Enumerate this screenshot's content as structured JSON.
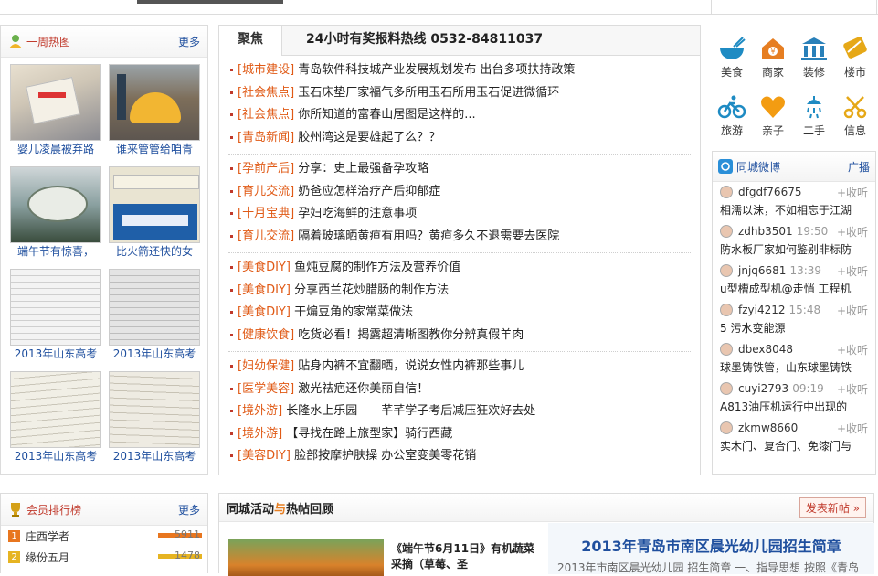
{
  "hot_week": {
    "title": "一周热图",
    "more": "更多",
    "items": [
      {
        "caption": "婴儿凌晨被弃路"
      },
      {
        "caption": "谁来管管给咱青"
      },
      {
        "caption": "端午节有惊喜，"
      },
      {
        "caption": "比火箭还快的女"
      },
      {
        "caption": "2013年山东高考"
      },
      {
        "caption": "2013年山东高考"
      },
      {
        "caption": "2013年山东高考"
      },
      {
        "caption": "2013年山东高考"
      }
    ]
  },
  "focus": {
    "tab_active": "聚焦",
    "hotline": "24小时有奖报料热线 0532-84811037",
    "groups": [
      [
        {
          "cat": "[城市建设]",
          "title": "青岛软件科技城产业发展规划发布 出台多项扶持政策"
        },
        {
          "cat": "[社会焦点]",
          "title": "玉石床垫厂家福气多所用玉石所用玉石促进微循环"
        },
        {
          "cat": "[社会焦点]",
          "title": "你所知道的富春山居图是这样的..."
        },
        {
          "cat": "[青岛新闻]",
          "title": "胶州湾这是要雄起了么？？"
        }
      ],
      [
        {
          "cat": "[孕前产后]",
          "title": "分享：史上最强备孕攻略"
        },
        {
          "cat": "[育儿交流]",
          "title": "奶爸应怎样治疗产后抑郁症"
        },
        {
          "cat": "[十月宝典]",
          "title": "孕妇吃海鲜的注意事项"
        },
        {
          "cat": "[育儿交流]",
          "title": "隔着玻璃晒黄疸有用吗？黄疸多久不退需要去医院"
        }
      ],
      [
        {
          "cat": "[美食DIY]",
          "title": "鱼炖豆腐的制作方法及营养价值"
        },
        {
          "cat": "[美食DIY]",
          "title": "分享西兰花炒腊肠的制作方法"
        },
        {
          "cat": "[美食DIY]",
          "title": "干煸豆角的家常菜做法"
        },
        {
          "cat": "[健康饮食]",
          "title": "吃货必看！揭露超清晰图教你分辨真假羊肉"
        }
      ],
      [
        {
          "cat": "[妇幼保健]",
          "title": "贴身内裤不宜翻晒，说说女性内裤那些事儿"
        },
        {
          "cat": "[医学美容]",
          "title": "激光祛疤还你美丽自信！"
        },
        {
          "cat": "[境外游]",
          "title": "长隆水上乐园——芊芊学子考后减压狂欢好去处"
        },
        {
          "cat": "[境外游]",
          "title": "【寻找在路上旅型家】骑行西藏"
        },
        {
          "cat": "[美容DIY]",
          "title": "脸部按摩护肤操 办公室变美零花销"
        }
      ]
    ]
  },
  "categories": [
    {
      "label": "美食",
      "icon": "food-bowl-icon",
      "color": "#1e8bc3"
    },
    {
      "label": "商家",
      "icon": "shop-house-icon",
      "color": "#e67e22"
    },
    {
      "label": "装修",
      "icon": "building-icon",
      "color": "#2980b9"
    },
    {
      "label": "楼市",
      "icon": "card-icon",
      "color": "#e6a817"
    },
    {
      "label": "旅游",
      "icon": "bicycle-icon",
      "color": "#1e8bc3"
    },
    {
      "label": "亲子",
      "icon": "heart-icon",
      "color": "#f39c12"
    },
    {
      "label": "二手",
      "icon": "shower-icon",
      "color": "#1e8bc3"
    },
    {
      "label": "信息",
      "icon": "scissors-icon",
      "color": "#e6a817"
    }
  ],
  "weibo": {
    "title": "同城微博",
    "broadcast": "广播",
    "follow": "+收听",
    "items": [
      {
        "user": "dfgdf76675",
        "time": "",
        "text": "相濡以沫，不如相忘于江湖"
      },
      {
        "user": "zdhb3501",
        "time": "19:50",
        "text": "防水板厂家如何鉴别非标防"
      },
      {
        "user": "jnjq6681",
        "time": "13:39",
        "text": "u型槽成型机@走悄 工程机"
      },
      {
        "user": "fzyi4212",
        "time": "15:48",
        "text": "5 污水变能源"
      },
      {
        "user": "dbex8048",
        "time": "",
        "text": "球墨铸铁管，山东球墨铸铁"
      },
      {
        "user": "cuyi2793",
        "time": "09:19",
        "text": "A813油压机运行中出现的"
      },
      {
        "user": "zkmw8660",
        "time": "",
        "text": "实木门、复合门、免漆门与"
      }
    ]
  },
  "rank": {
    "title": "会员排行榜",
    "more": "更多",
    "items": [
      {
        "num": "1",
        "name": "庄西学者",
        "value": "5911",
        "color": "#e8761f"
      },
      {
        "num": "2",
        "name": "缘份五月",
        "value": "1478",
        "color": "#e6b422"
      }
    ]
  },
  "activity": {
    "title_a": "同城活动",
    "title_and": "与",
    "title_b": "热帖回顾",
    "post_btn": "发表新帖 »",
    "card_title": "《端午节6月11日》有机蔬菜采摘（草莓、圣",
    "headline": "2013年青岛市南区晨光幼儿园招生简章",
    "snippet": "2013年市南区晨光幼儿园 招生简章 一、指导思想 按照《青岛"
  }
}
